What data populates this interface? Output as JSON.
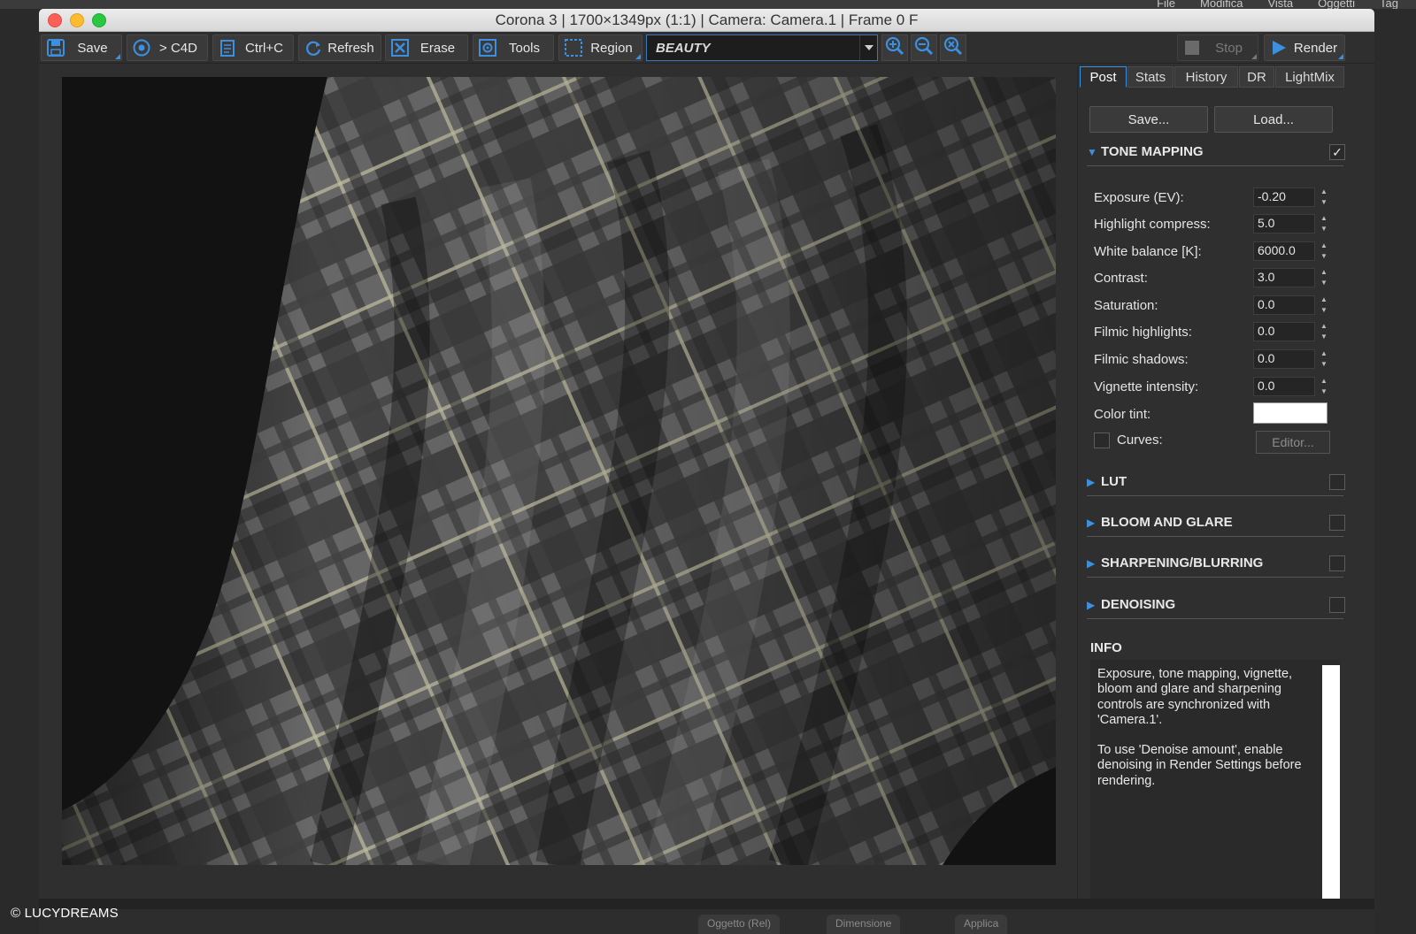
{
  "host": {
    "menu": [
      "File",
      "Modifica",
      "Vista",
      "Oggetti",
      "Tag"
    ],
    "bottom_tabs": [
      "Oggetto (Rel)",
      "Dimensione",
      "Applica"
    ]
  },
  "window": {
    "title": "Corona 3 | 1700×1349px (1:1) | Camera: Camera.1 | Frame 0 F"
  },
  "toolbar": {
    "save_label": "Save",
    "to_c4d_label": "> C4D",
    "copy_label": "Ctrl+C",
    "refresh_label": "Refresh",
    "erase_label": "Erase",
    "tools_label": "Tools",
    "region_label": "Region",
    "pass_value": "BEAUTY",
    "stop_label": "Stop",
    "render_label": "Render"
  },
  "panel": {
    "tabs": [
      "Post",
      "Stats",
      "History",
      "DR",
      "LightMix"
    ],
    "save_button": "Save...",
    "load_button": "Load...",
    "tone_mapping": {
      "title": "TONE MAPPING",
      "enabled": true,
      "params": [
        {
          "label": "Exposure (EV):",
          "value": "-0.20"
        },
        {
          "label": "Highlight compress:",
          "value": "5.0"
        },
        {
          "label": "White balance [K]:",
          "value": "6000.0"
        },
        {
          "label": "Contrast:",
          "value": "3.0"
        },
        {
          "label": "Saturation:",
          "value": "0.0"
        },
        {
          "label": "Filmic highlights:",
          "value": "0.0"
        },
        {
          "label": "Filmic shadows:",
          "value": "0.0"
        },
        {
          "label": "Vignette intensity:",
          "value": "0.0"
        }
      ],
      "color_tint_label": "Color tint:",
      "color_tint_value": "#ffffff",
      "curves_label": "Curves:",
      "editor_label": "Editor..."
    },
    "sections": [
      {
        "title": "LUT"
      },
      {
        "title": "BLOOM AND GLARE"
      },
      {
        "title": "SHARPENING/BLURRING"
      },
      {
        "title": "DENOISING"
      }
    ],
    "info_title": "INFO",
    "info_text_1": "Exposure, tone mapping, vignette, bloom and glare and sharpening controls are synchronized with 'Camera.1'.",
    "info_text_2": "To use 'Denoise amount', enable denoising in Render Settings before rendering."
  },
  "watermark": "© LUCYDREAMS",
  "colors": {
    "accent": "#3d8fe0",
    "panel_bg": "#2f2f2f",
    "render_bg": "#121212"
  }
}
